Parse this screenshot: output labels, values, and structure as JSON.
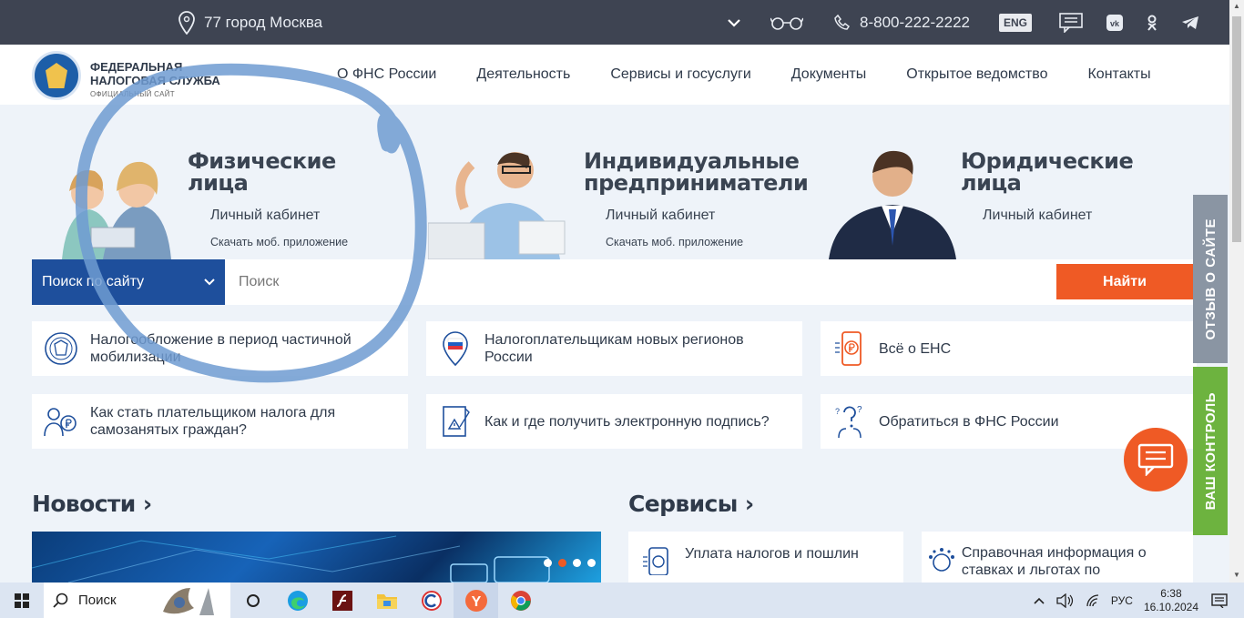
{
  "topbar": {
    "location": "77 город Москва",
    "phone": "8-800-222-2222",
    "lang_button": "ENG"
  },
  "header": {
    "logo_line1": "ФЕДЕРАЛЬНАЯ",
    "logo_line2": "НАЛОГОВАЯ СЛУЖБА",
    "logo_sub": "ОФИЦИАЛЬНЫЙ САЙТ",
    "nav": [
      "О ФНС России",
      "Деятельность",
      "Сервисы и госуслуги",
      "Документы",
      "Открытое ведомство",
      "Контакты"
    ]
  },
  "hero": {
    "individuals": {
      "title1": "Физические",
      "title2": "лица",
      "cabinet": "Личный кабинет",
      "app": "Скачать моб. приложение"
    },
    "entrepreneurs": {
      "title1": "Индивидуальные",
      "title2": "предприниматели",
      "cabinet": "Личный кабинет",
      "app": "Скачать моб. приложение"
    },
    "legal": {
      "title1": "Юридические",
      "title2": "лица",
      "cabinet": "Личный кабинет"
    }
  },
  "search": {
    "scope": "Поиск по сайту",
    "placeholder": "Поиск",
    "button": "Найти"
  },
  "tiles": [
    {
      "text": "Налогообложение в период частичной мобилизации",
      "icon": "fns-emblem-icon"
    },
    {
      "text": "Налогоплательщикам новых регионов России",
      "icon": "map-pin-flag-icon"
    },
    {
      "text": "Всё о ЕНС",
      "icon": "phone-ruble-icon"
    },
    {
      "text": "Как стать плательщиком налога для самозанятых граждан?",
      "icon": "self-employed-icon"
    },
    {
      "text": "Как и где получить электронную подпись?",
      "icon": "e-signature-icon"
    },
    {
      "text": "Обратиться в ФНС России",
      "icon": "question-person-icon"
    }
  ],
  "sections": {
    "news": "Новости",
    "services": "Сервисы",
    "service_items": [
      "Уплата налогов и пошлин",
      "Справочная информация о ставках и льготах по"
    ]
  },
  "side_tabs": {
    "feedback": "ОТЗЫВ О САЙТЕ",
    "control": "ВАШ КОНТРОЛЬ"
  },
  "taskbar": {
    "search": "Поиск",
    "lang": "РУС",
    "time": "6:38",
    "date": "16.10.2024"
  },
  "colors": {
    "accent_orange": "#ef5a25",
    "brand_blue": "#1e4f9c",
    "topbar": "#3e4452",
    "annotation_pen": "#6f9bd1"
  }
}
